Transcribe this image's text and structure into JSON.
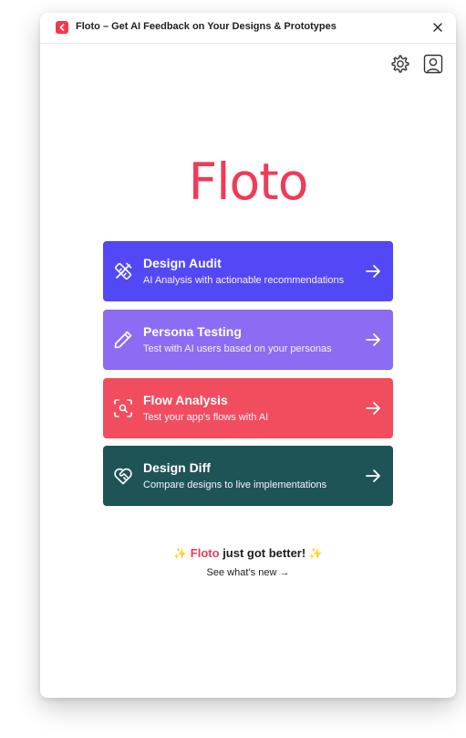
{
  "window": {
    "title": "Floto – Get AI Feedback on Your Designs & Prototypes"
  },
  "logo": {
    "text": "Floto",
    "color": "#ef3b55"
  },
  "cards": [
    {
      "title": "Design Audit",
      "subtitle": "AI Analysis with actionable recommendations",
      "color": "#5248f6",
      "icon": "tools-icon"
    },
    {
      "title": "Persona Testing",
      "subtitle": "Test with AI users based on your personas",
      "color": "#8b6cf2",
      "icon": "pencil-icon"
    },
    {
      "title": "Flow Analysis",
      "subtitle": "Test your app's flows with AI",
      "color": "#f24d5f",
      "icon": "scan-search-icon"
    },
    {
      "title": "Design Diff",
      "subtitle": "Compare designs to live implementations",
      "color": "#1f5457",
      "icon": "heart-handshake-icon"
    }
  ],
  "announcement": {
    "spark": "✨",
    "brand": "Floto",
    "text": "just got better!",
    "link": "See what’s new →"
  }
}
